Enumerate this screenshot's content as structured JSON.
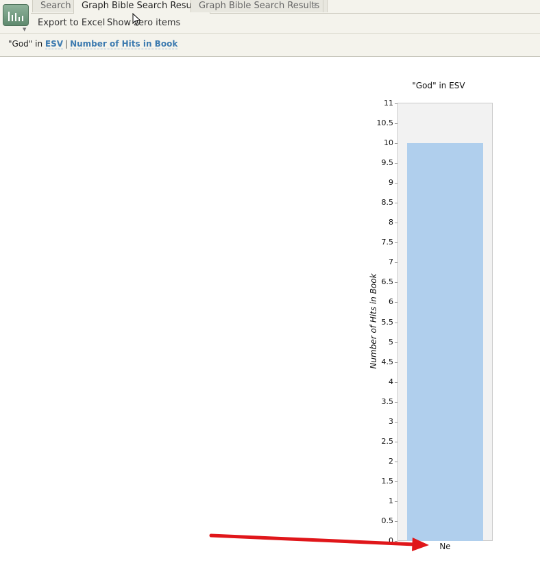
{
  "tabs": {
    "search": "Search",
    "graph1": "Graph Bible Search Results",
    "graph2": "Graph Bible Search Results",
    "add": "+"
  },
  "toolbar": {
    "export": "Export to Excel",
    "show_zero": "Show zero items"
  },
  "breadcrumb": {
    "query": "\"God\" in",
    "version": "ESV",
    "pipe": "|",
    "metric": "Number of Hits in Book"
  },
  "chart_data": {
    "type": "bar",
    "title": "\"God\" in ESV",
    "ylabel": "Number of Hits in Book",
    "xlabel": "",
    "categories": [
      "Ne"
    ],
    "values": [
      10
    ],
    "ylim": [
      0,
      11
    ],
    "yticks": [
      "0",
      "0.5",
      "1",
      "1.5",
      "2",
      "2.5",
      "3",
      "3.5",
      "4",
      "4.5",
      "5",
      "5.5",
      "6",
      "6.5",
      "7",
      "7.5",
      "8",
      "8.5",
      "9",
      "9.5",
      "10",
      "10.5",
      "11"
    ],
    "grid": true,
    "bar_color": "#b0cfed"
  },
  "colors": {
    "accent_link": "#3d7bb0",
    "annotation_arrow": "#e0161a"
  }
}
